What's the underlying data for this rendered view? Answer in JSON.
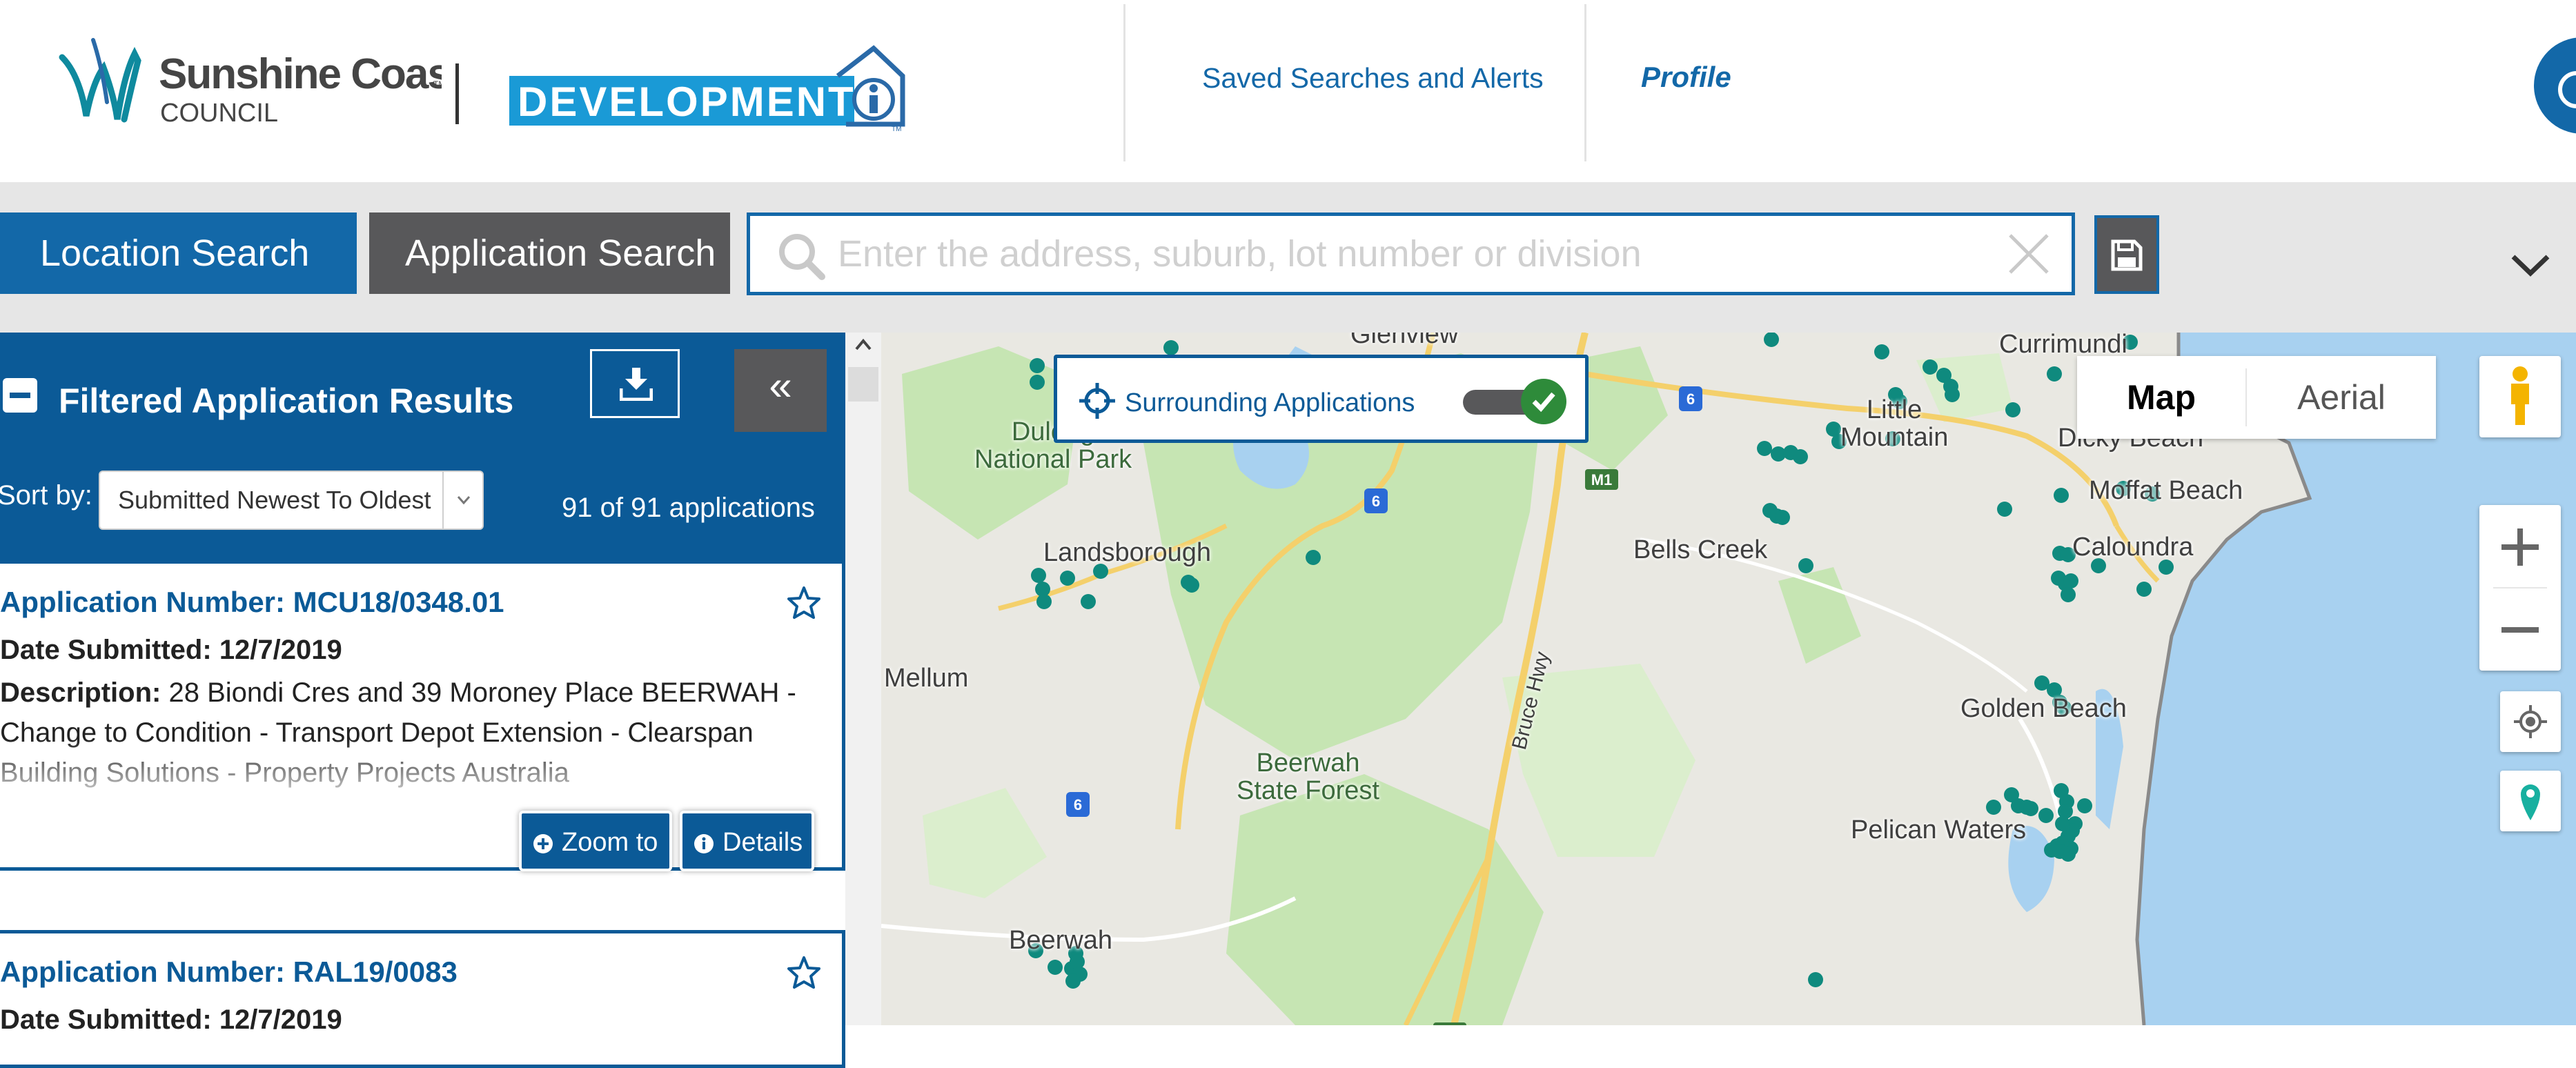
{
  "header": {
    "logo_scc_line1": "Sunshine Coast",
    "logo_scc_tm": "TM",
    "logo_scc_line2": "COUNCIL",
    "logo_dev": "DEVELOPMENT",
    "logo_dev_tm": "TM",
    "nav_saved": "Saved Searches and Alerts",
    "nav_profile": "Profile"
  },
  "searchbar": {
    "tab_location": "Location Search",
    "tab_application": "Application Search",
    "placeholder": "Enter the address, suburb, lot number or division"
  },
  "sidebar": {
    "title": "Filtered Application Results",
    "sort_label": "Sort by:",
    "sort_selected": "Submitted Newest To Oldest",
    "collapse_label": "«",
    "result_count": "91 of 91 applications",
    "cards": [
      {
        "title": "Application Number: MCU18/0348.01",
        "date_label": "Date Submitted:",
        "date_value": "12/7/2019",
        "desc_label": "Description:",
        "desc_value": "28 Biondi Cres and 39 Moroney Place BEERWAH - Change to Condition - Transport Depot Extension - Clearspan Building Solutions - Property Projects Australia",
        "zoom_label": "Zoom to",
        "details_label": "Details"
      },
      {
        "title": "Application Number: RAL19/0083",
        "date_label": "Date Submitted:",
        "date_value": "12/7/2019"
      }
    ]
  },
  "map": {
    "surrounding_label": "Surrounding Applications",
    "surrounding_on": true,
    "maptype_map": "Map",
    "maptype_aerial": "Aerial",
    "labels": {
      "glenview": "Glenview",
      "currimundi": "Currimundi",
      "little_mountain": "Little\nMountain",
      "dicky_beach": "Dicky Beach",
      "moffat_beach": "Moffat Beach",
      "caloundra": "Caloundra",
      "bells_creek": "Bells Creek",
      "dulong_np": "Dulong\nNational Park",
      "landsborough": "Landsborough",
      "mellum": "Mellum",
      "golden_beach": "Golden Beach",
      "beerwah_sf": "Beerwah\nState Forest",
      "bruce_hwy": "Bruce Hwy",
      "pelican_waters": "Pelican Waters",
      "beerwah": "Beerwah"
    },
    "shields": {
      "m1": "M1",
      "r6": "6"
    },
    "colors": {
      "marker": "#0f8a7e",
      "water": "#a8d1f0",
      "park": "#c6e5b3",
      "road": "#f4d06b",
      "brand_blue": "#1368a8",
      "dark_blue": "#0b5a97"
    }
  }
}
